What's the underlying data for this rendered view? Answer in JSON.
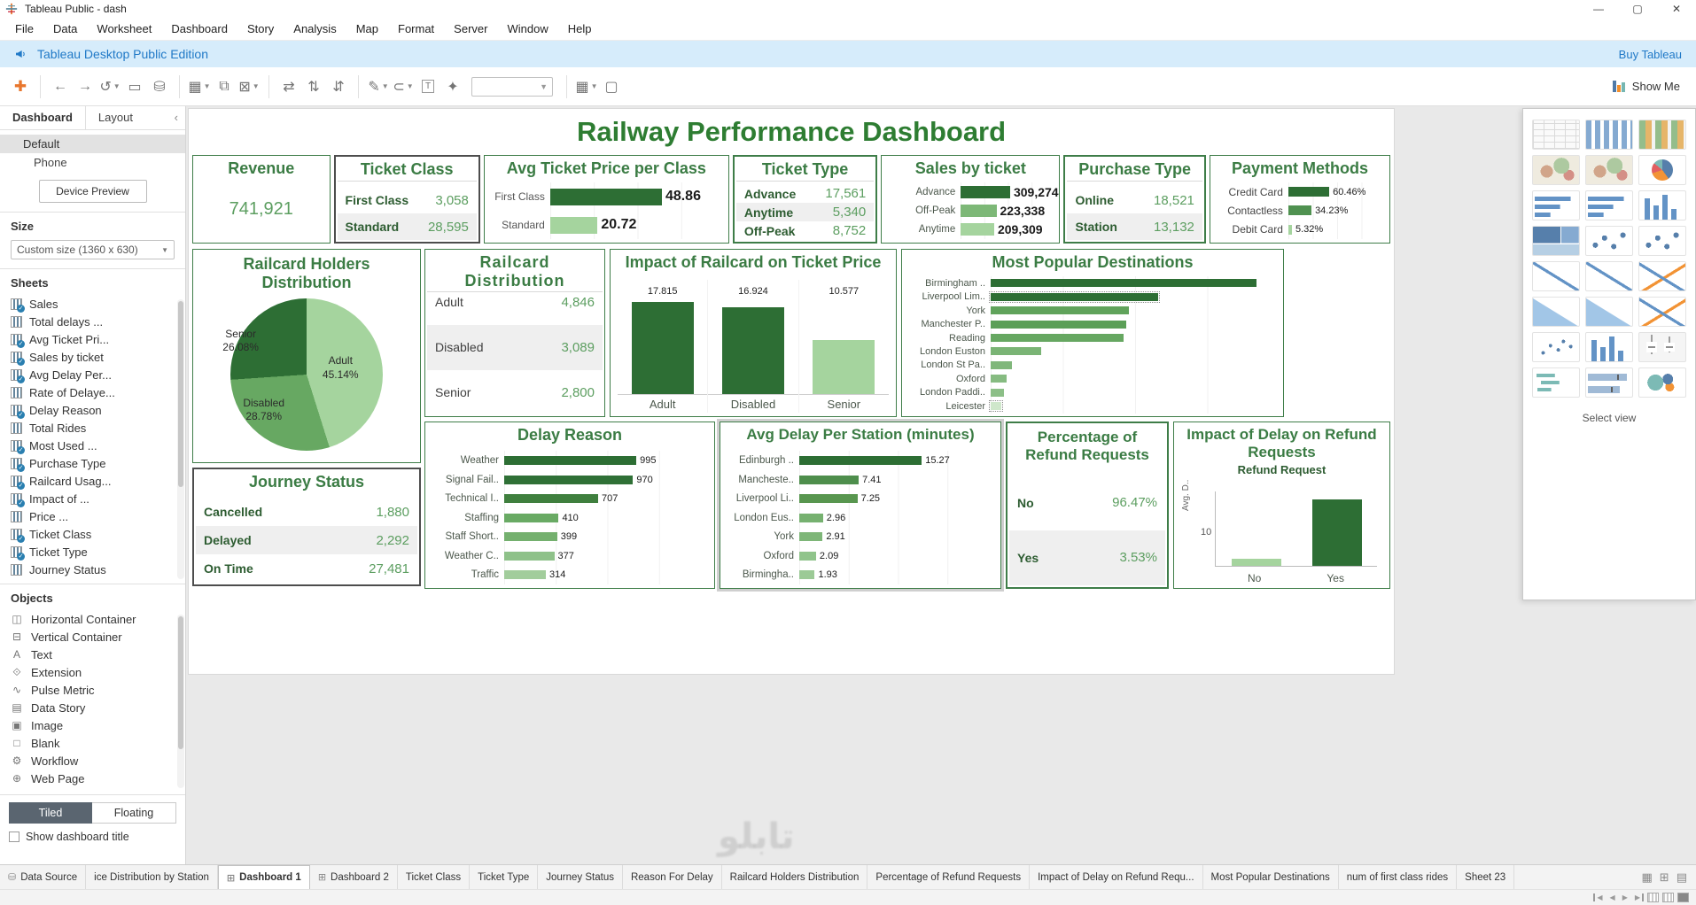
{
  "window": {
    "title": "Tableau Public - dash"
  },
  "menu": {
    "items": [
      "File",
      "Data",
      "Worksheet",
      "Dashboard",
      "Story",
      "Analysis",
      "Map",
      "Format",
      "Server",
      "Window",
      "Help"
    ]
  },
  "banner": {
    "text": "Tableau Desktop Public Edition",
    "action": "Buy Tableau"
  },
  "toolbar": {
    "show_me_label": "Show Me",
    "icons": [
      {
        "kind": "icon",
        "name": "tableau-logo-icon",
        "glyph": "✚",
        "colored": true
      },
      {
        "kind": "sep"
      },
      {
        "kind": "icon",
        "name": "back-icon",
        "glyph": "←"
      },
      {
        "kind": "icon",
        "name": "forward-icon",
        "glyph": "→"
      },
      {
        "kind": "icon",
        "name": "undo-icon",
        "glyph": "↺",
        "caret": true
      },
      {
        "kind": "icon",
        "name": "save-icon",
        "glyph": "▭"
      },
      {
        "kind": "icon",
        "name": "add-data-icon",
        "glyph": "⛁"
      },
      {
        "kind": "sep"
      },
      {
        "kind": "icon",
        "name": "new-worksheet-icon",
        "glyph": "▦",
        "caret": true
      },
      {
        "kind": "icon",
        "name": "duplicate-icon",
        "glyph": "⧉"
      },
      {
        "kind": "icon",
        "name": "clear-sheet-icon",
        "glyph": "⊠",
        "caret": true
      },
      {
        "kind": "sep"
      },
      {
        "kind": "icon",
        "name": "swap-axes-icon",
        "glyph": "⇄"
      },
      {
        "kind": "icon",
        "name": "sort-ascending-icon",
        "glyph": "⇅"
      },
      {
        "kind": "icon",
        "name": "sort-descending-icon",
        "glyph": "⇵"
      },
      {
        "kind": "sep"
      },
      {
        "kind": "icon",
        "name": "highlight-icon",
        "glyph": "✎",
        "caret": true
      },
      {
        "kind": "icon",
        "name": "group-icon",
        "glyph": "⊂",
        "caret": true
      },
      {
        "kind": "icon",
        "name": "text-label-icon",
        "glyph": "T",
        "boxed": true
      },
      {
        "kind": "icon",
        "name": "fix-axes-icon",
        "glyph": "✦"
      },
      {
        "kind": "combo",
        "name": "fit-select"
      },
      {
        "kind": "sep"
      },
      {
        "kind": "icon",
        "name": "show-cards-icon",
        "glyph": "▦",
        "caret": true
      },
      {
        "kind": "icon",
        "name": "presentation-icon",
        "glyph": "▢"
      }
    ]
  },
  "sidebar": {
    "tabs": [
      {
        "label": "Dashboard"
      },
      {
        "label": "Layout"
      }
    ],
    "device": {
      "default_label": "Default",
      "phone_label": "Phone",
      "preview_button": "Device Preview"
    },
    "size": {
      "header": "Size",
      "value": "Custom size (1360 x 630)"
    },
    "sheets": {
      "header": "Sheets",
      "items": [
        {
          "label": "Sales",
          "used": true
        },
        {
          "label": "Total delays ...",
          "used": false
        },
        {
          "label": "Avg Ticket Pri...",
          "used": true
        },
        {
          "label": "Sales by ticket",
          "used": true
        },
        {
          "label": " Avg Delay Per...",
          "used": true
        },
        {
          "label": "Rate of Delaye...",
          "used": false
        },
        {
          "label": "Delay Reason",
          "used": true
        },
        {
          "label": "Total Rides",
          "used": false
        },
        {
          "label": "Most Used ...",
          "used": true
        },
        {
          "label": "Purchase Type",
          "used": true
        },
        {
          "label": "Railcard Usag...",
          "used": true
        },
        {
          "label": "Impact of ...",
          "used": true
        },
        {
          "label": "Price ...",
          "used": false
        },
        {
          "label": "Ticket Class",
          "used": true
        },
        {
          "label": "Ticket Type",
          "used": true
        },
        {
          "label": "Journey Status",
          "used": false
        }
      ]
    },
    "objects": {
      "header": "Objects",
      "items": [
        "Horizontal Container",
        "Vertical Container",
        "Text",
        "Extension",
        "Pulse Metric",
        "Data Story",
        "Image",
        "Blank",
        "Workflow",
        "Web Page"
      ]
    },
    "layout_toggle": {
      "tiled": "Tiled",
      "floating": "Floating"
    },
    "show_title_label": "Show dashboard title"
  },
  "dashboard": {
    "title": "Railway Performance Dashboard",
    "row1": {
      "revenue": {
        "title": "Revenue",
        "value": "741,921"
      },
      "ticket_class": {
        "title": "Ticket Class",
        "rows": [
          {
            "label": "First Class",
            "value": "3,058"
          },
          {
            "label": "Standard",
            "value": "28,595"
          }
        ]
      },
      "avg_ticket_price": {
        "title": "Avg Ticket Price per Class",
        "bars": [
          {
            "label": "First Class",
            "value": "48.86",
            "v": 48.86,
            "color": "#2d6e34"
          },
          {
            "label": "Standard",
            "value": "20.72",
            "v": 20.72,
            "color": "#a5d49e"
          }
        ]
      },
      "ticket_type": {
        "title": "Ticket Type",
        "rows": [
          {
            "label": "Advance",
            "value": "17,561"
          },
          {
            "label": "Anytime",
            "value": "5,340"
          },
          {
            "label": "Off-Peak",
            "value": "8,752"
          }
        ]
      },
      "sales_by_ticket": {
        "title": "Sales by ticket",
        "bars": [
          {
            "label": "Advance",
            "value": "309,274",
            "v": 309274,
            "color": "#2d6e34"
          },
          {
            "label": "Off-Peak",
            "value": "223,338",
            "v": 223338,
            "color": "#7db877"
          },
          {
            "label": "Anytime",
            "value": "209,309",
            "v": 209309,
            "color": "#a5d49e"
          }
        ]
      },
      "purchase_type": {
        "title": "Purchase Type",
        "rows": [
          {
            "label": "Online",
            "value": "18,521"
          },
          {
            "label": "Station",
            "value": "13,132"
          }
        ]
      },
      "payment_methods": {
        "title": "Payment Methods",
        "bars": [
          {
            "label": "Credit Card",
            "value": "60.46%",
            "v": 60.46,
            "color": "#2d6e34"
          },
          {
            "label": "Contactless",
            "value": "34.23%",
            "v": 34.23,
            "color": "#4f9150"
          },
          {
            "label": "Debit Card",
            "value": "5.32%",
            "v": 5.32,
            "color": "#a5d49e"
          }
        ]
      }
    },
    "railcard_pie": {
      "title": "Railcard Holders Distribution",
      "slices": [
        {
          "label": "Adult",
          "pct": 45.14,
          "display": "45.14%",
          "color": "#a5d49e"
        },
        {
          "label": "Disabled",
          "pct": 28.78,
          "display": "28.78%",
          "color": "#67a862"
        },
        {
          "label": "Senior",
          "pct": 26.08,
          "display": "26.08%",
          "color": "#2d6e34"
        }
      ]
    },
    "journey_status": {
      "title": "Journey Status",
      "rows": [
        {
          "label": "Cancelled",
          "value": "1,880"
        },
        {
          "label": "Delayed",
          "value": "2,292"
        },
        {
          "label": "On Time",
          "value": "27,481"
        }
      ]
    },
    "railcard_distribution": {
      "title": "Railcard Distribution",
      "rows": [
        {
          "label": "Adult",
          "value": "4,846"
        },
        {
          "label": "Disabled",
          "value": "3,089"
        },
        {
          "label": "Senior",
          "value": "2,800"
        }
      ]
    },
    "impact_railcard": {
      "title": "Impact of Railcard on Ticket Price",
      "bars": [
        {
          "label": "Adult",
          "value": "17.815",
          "v": 17.815,
          "color": "#2d6e34"
        },
        {
          "label": "Disabled",
          "value": "16.924",
          "v": 16.924,
          "color": "#2d6e34"
        },
        {
          "label": "Senior",
          "value": "10.577",
          "v": 10.577,
          "color": "#a5d49e"
        }
      ]
    },
    "destinations": {
      "title": "Most Popular Destinations",
      "bars": [
        {
          "label": "Birmingham ..",
          "v": 100,
          "color": "#2d6e34"
        },
        {
          "label": "Liverpool Lim..",
          "v": 63,
          "color": "#2d6e34",
          "dotted": true
        },
        {
          "label": "York",
          "v": 52,
          "color": "#60a35b"
        },
        {
          "label": "Manchester P..",
          "v": 51,
          "color": "#5b9f57"
        },
        {
          "label": "Reading",
          "v": 50,
          "color": "#66a761"
        },
        {
          "label": "London Euston",
          "v": 19,
          "color": "#7ab475"
        },
        {
          "label": "London St Pa..",
          "v": 8,
          "color": "#80b77b"
        },
        {
          "label": "Oxford",
          "v": 6,
          "color": "#86bb81"
        },
        {
          "label": "London Paddi..",
          "v": 5,
          "color": "#8cbf87"
        },
        {
          "label": "Leicester",
          "v": 4,
          "color": "#cfe7cb",
          "dotted": true
        }
      ]
    },
    "delay_reason": {
      "title": "Delay Reason",
      "bars": [
        {
          "label": "Weather",
          "value": "995",
          "v": 995,
          "color": "#2d6e34"
        },
        {
          "label": "Signal Fail..",
          "value": "970",
          "v": 970,
          "color": "#2f7036"
        },
        {
          "label": "Technical I..",
          "value": "707",
          "v": 707,
          "color": "#3f7f3e"
        },
        {
          "label": "Staffing",
          "value": "410",
          "v": 410,
          "color": "#69aa64"
        },
        {
          "label": "Staff Short..",
          "value": "399",
          "v": 399,
          "color": "#74b06e"
        },
        {
          "label": "Weather C..",
          "value": "377",
          "v": 377,
          "color": "#8ec189"
        },
        {
          "label": "Traffic",
          "value": "314",
          "v": 314,
          "color": "#a2cd9c"
        }
      ]
    },
    "avg_delay": {
      "title": "Avg Delay Per Station (minutes)",
      "bars": [
        {
          "label": "Edinburgh ..",
          "value": "15.27",
          "v": 15.27,
          "color": "#2d6e34"
        },
        {
          "label": "Mancheste..",
          "value": "7.41",
          "v": 7.41,
          "color": "#4e8e4c"
        },
        {
          "label": "Liverpool Li..",
          "value": "7.25",
          "v": 7.25,
          "color": "#58964f"
        },
        {
          "label": "London Eus..",
          "value": "2.96",
          "v": 2.96,
          "color": "#76b170"
        },
        {
          "label": "York",
          "value": "2.91",
          "v": 2.91,
          "color": "#7eb678"
        },
        {
          "label": "Oxford",
          "value": "2.09",
          "v": 2.09,
          "color": "#90c48b"
        },
        {
          "label": "Birmingha..",
          "value": "1.93",
          "v": 1.93,
          "color": "#9cca96"
        }
      ]
    },
    "refund_pct": {
      "title": "Percentage of Refund Requests",
      "rows": [
        {
          "label": "No",
          "value": "96.47%"
        },
        {
          "label": "Yes",
          "value": "3.53%"
        }
      ]
    },
    "impact_delay": {
      "title": "Impact of Delay on Refund Requests",
      "chart_title": "Refund Request",
      "y_label": "Avg. D..",
      "y_tick": "10",
      "bars": [
        {
          "label": "No",
          "pct": 9,
          "color": "#a5d49e"
        },
        {
          "label": "Yes",
          "pct": 90,
          "color": "#2d6e34"
        }
      ]
    }
  },
  "show_me": {
    "select_view": "Select view",
    "tiles": [
      "text-table",
      "heat-map",
      "highlight-table",
      "symbol-map",
      "filled-map",
      "pie-chart",
      "horizontal-bars",
      "stacked-bars",
      "side-by-side-bars",
      "treemap",
      "circle-views",
      "side-by-side-circles",
      "continuous-lines",
      "discrete-lines",
      "dual-lines",
      "area-continuous",
      "area-discrete",
      "dual-combination",
      "scatter-plot",
      "histogram",
      "box-and-whisker",
      "gantt",
      "bullet-graph",
      "packed-bubbles"
    ]
  },
  "tabs": {
    "items": [
      {
        "label": "Data Source",
        "type": "datasource"
      },
      {
        "label": "ice Distribution by Station",
        "type": "sheet"
      },
      {
        "label": "Dashboard 1",
        "type": "dashboard",
        "active": true
      },
      {
        "label": "Dashboard 2",
        "type": "dashboard"
      },
      {
        "label": "Ticket Class",
        "type": "sheet"
      },
      {
        "label": "Ticket Type",
        "type": "sheet"
      },
      {
        "label": "Journey Status",
        "type": "sheet"
      },
      {
        "label": "Reason For Delay",
        "type": "sheet"
      },
      {
        "label": "Railcard Holders Distribution",
        "type": "sheet"
      },
      {
        "label": "Percentage of Refund Requests",
        "type": "sheet"
      },
      {
        "label": "Impact of Delay on Refund Requ...",
        "type": "sheet"
      },
      {
        "label": "Most Popular Destinations",
        "type": "sheet"
      },
      {
        "label": "num of first class rides",
        "type": "sheet"
      },
      {
        "label": "Sheet 23",
        "type": "sheet"
      }
    ]
  },
  "colors": {
    "dark_green": "#2d6e34",
    "medium_green": "#67a862",
    "light_green": "#a5d49e",
    "title_green": "#2e7d32",
    "accent_blue": "#2079c7"
  }
}
